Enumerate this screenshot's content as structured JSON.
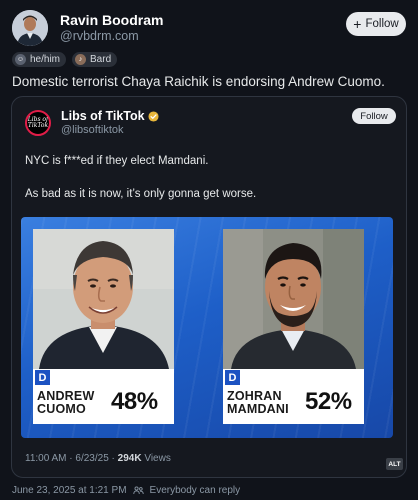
{
  "post": {
    "author_name": "Ravin Boodram",
    "author_handle": "@rvbdrm.com",
    "follow_label": "Follow",
    "badges": [
      {
        "label": "he/him",
        "icon": "pronoun-icon"
      },
      {
        "label": "Bard",
        "icon": "bard-icon"
      }
    ],
    "text": "Domestic terrorist Chaya Raichik is endorsing Andrew Cuomo."
  },
  "quote": {
    "name": "Libs of TikTok",
    "handle": "@libsoftiktok",
    "follow_label": "Follow",
    "avatar_logo_text": "Libs of TikTok",
    "line1": "NYC is f***ed if they elect Mamdani.",
    "line2": "As bad as it is now, it’s only gonna get worse.",
    "image": {
      "candidates": [
        {
          "party": "D",
          "name": "ANDREW\nCUOMO",
          "percent": "48%"
        },
        {
          "party": "D",
          "name": "ZOHRAN\nMAMDANI",
          "percent": "52%"
        }
      ],
      "alt_badge": "ALT"
    },
    "meta_prefix": "11:00 AM · 6/23/25 · ",
    "views_count": "294K",
    "views_suffix": " Views"
  },
  "footer": {
    "timestamp": "June 23, 2025 at 1:21 PM",
    "audience": "Everybody can reply"
  },
  "colors": {
    "background": "#10131a",
    "party_blue": "#1c52c2",
    "verified_gold": "#e8b63a",
    "tiktok_red": "#e11d48"
  }
}
